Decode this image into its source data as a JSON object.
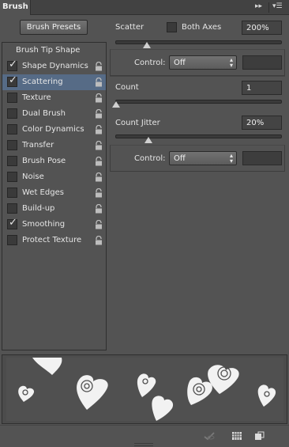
{
  "panel": {
    "tab_title": "Brush",
    "tab_controls": {
      "collapse_icon": "double-chevron-right-icon",
      "menu_icon": "panel-menu-icon"
    }
  },
  "presets_button": "Brush Presets",
  "list": {
    "header": "Brush Tip Shape",
    "items": [
      {
        "label": "Shape Dynamics",
        "checked": true,
        "selected": false
      },
      {
        "label": "Scattering",
        "checked": true,
        "selected": true
      },
      {
        "label": "Texture",
        "checked": false,
        "selected": false
      },
      {
        "label": "Dual Brush",
        "checked": false,
        "selected": false
      },
      {
        "label": "Color Dynamics",
        "checked": false,
        "selected": false
      },
      {
        "label": "Transfer",
        "checked": false,
        "selected": false
      },
      {
        "label": "Brush Pose",
        "checked": false,
        "selected": false
      },
      {
        "label": "Noise",
        "checked": false,
        "selected": false
      },
      {
        "label": "Wet Edges",
        "checked": false,
        "selected": false
      },
      {
        "label": "Build-up",
        "checked": false,
        "selected": false
      },
      {
        "label": "Smoothing",
        "checked": true,
        "selected": false
      },
      {
        "label": "Protect Texture",
        "checked": false,
        "selected": false
      }
    ]
  },
  "scatter": {
    "label": "Scatter",
    "both_axes_label": "Both Axes",
    "both_axes_checked": false,
    "value": "200%",
    "slider_fraction": 0.19,
    "control_label": "Control:",
    "control_value": "Off"
  },
  "count": {
    "label": "Count",
    "value": "1",
    "slider_fraction": 0.0
  },
  "count_jitter": {
    "label": "Count Jitter",
    "value": "20%",
    "slider_fraction": 0.2,
    "control_label": "Control:",
    "control_value": "Off"
  },
  "bottom_icons": [
    "brush-visibility-icon",
    "grid-icon",
    "new-preset-icon"
  ],
  "colors": {
    "panel_bg": "#535353",
    "selection": "#566b86",
    "preview_bg": "#505050"
  }
}
